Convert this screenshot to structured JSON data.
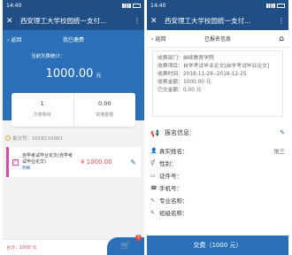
{
  "left": {
    "status_time": "14:40",
    "wx_title": "西安理工大学校园统一支付...",
    "nav": {
      "back": "返回",
      "title": "我已缴费"
    },
    "head": {
      "label": "当前欠费统计：",
      "amount": "1000.00",
      "unit": "元"
    },
    "stats": [
      {
        "value": "1",
        "caption": "欠缴条目"
      },
      {
        "value": "0.00",
        "caption": "实缴金额"
      }
    ],
    "batch": "批次号：2018110001",
    "item": {
      "name": "自学考试毕业论文(自学考试毕业论文)",
      "tag": "明细",
      "price": "¥ 1000.00"
    },
    "total": "合计：1000 元",
    "cart_badge": "1"
  },
  "right": {
    "status_time": "14:40",
    "wx_title": "西安理工大学校园统一支付...",
    "nav": {
      "back": "返回",
      "title": "已报名信息"
    },
    "info": [
      "收费部门：继续教育学院",
      "收费项目：自学考试毕业论文[自学考试毕业论文]",
      "收费时间：2018-11-29--2018-12-25",
      "收费金额：1000.00 元",
      "已交金额：0.00 元"
    ],
    "section": "报名信息：",
    "fields": [
      {
        "label": "真实姓名：",
        "value": "张三"
      },
      {
        "label": "性别：",
        "value": ""
      },
      {
        "label": "证件号：",
        "value": ""
      },
      {
        "label": "手机号：",
        "value": ""
      },
      {
        "label": "专业名称：",
        "value": ""
      },
      {
        "label": "班级名称：",
        "value": ""
      }
    ],
    "pay_button": "交费（1000 元）"
  }
}
